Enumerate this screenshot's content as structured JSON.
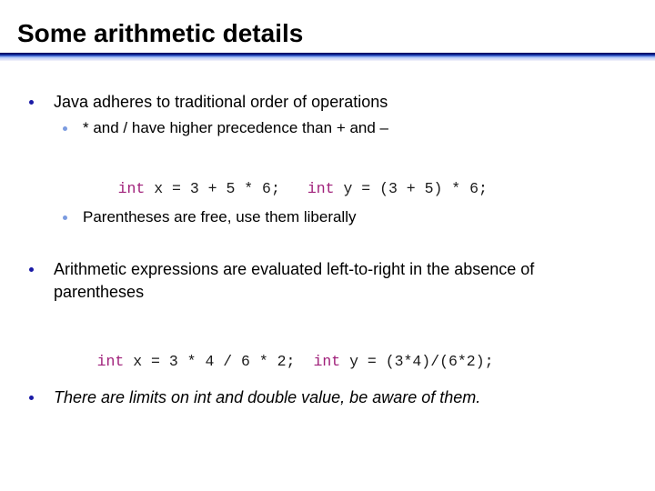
{
  "slide": {
    "title": "Some arithmetic details",
    "colors": {
      "title_rule_dark": "#000a5a",
      "title_rule_light": "#c9d6f8",
      "bullet_level1": "#1a1aa6",
      "bullet_level2": "#7b9be0",
      "code_keyword": "#a0207a",
      "text": "#000000"
    }
  },
  "content": {
    "bullet1": {
      "text": "Java adheres to traditional order of operations",
      "sub1": "* and /  have higher precedence than + and –",
      "code": {
        "left_keyword": "int",
        "left_rest": " x = 3 + 5 * 6;",
        "right_keyword": "int",
        "right_rest": " y = (3 + 5) * 6;"
      },
      "sub2": "Parentheses are free, use them liberally"
    },
    "bullet2": {
      "line1": "Arithmetic expressions are evaluated left-to-right in the absence of",
      "line2": "parentheses",
      "code": {
        "left_keyword": "int",
        "left_rest": " x = 3 * 4 / 6 * 2;",
        "right_keyword": "int",
        "right_rest": " y = (3*4)/(6*2);"
      }
    },
    "bullet3": {
      "text": "There are limits on int and double value, be aware of them."
    }
  }
}
